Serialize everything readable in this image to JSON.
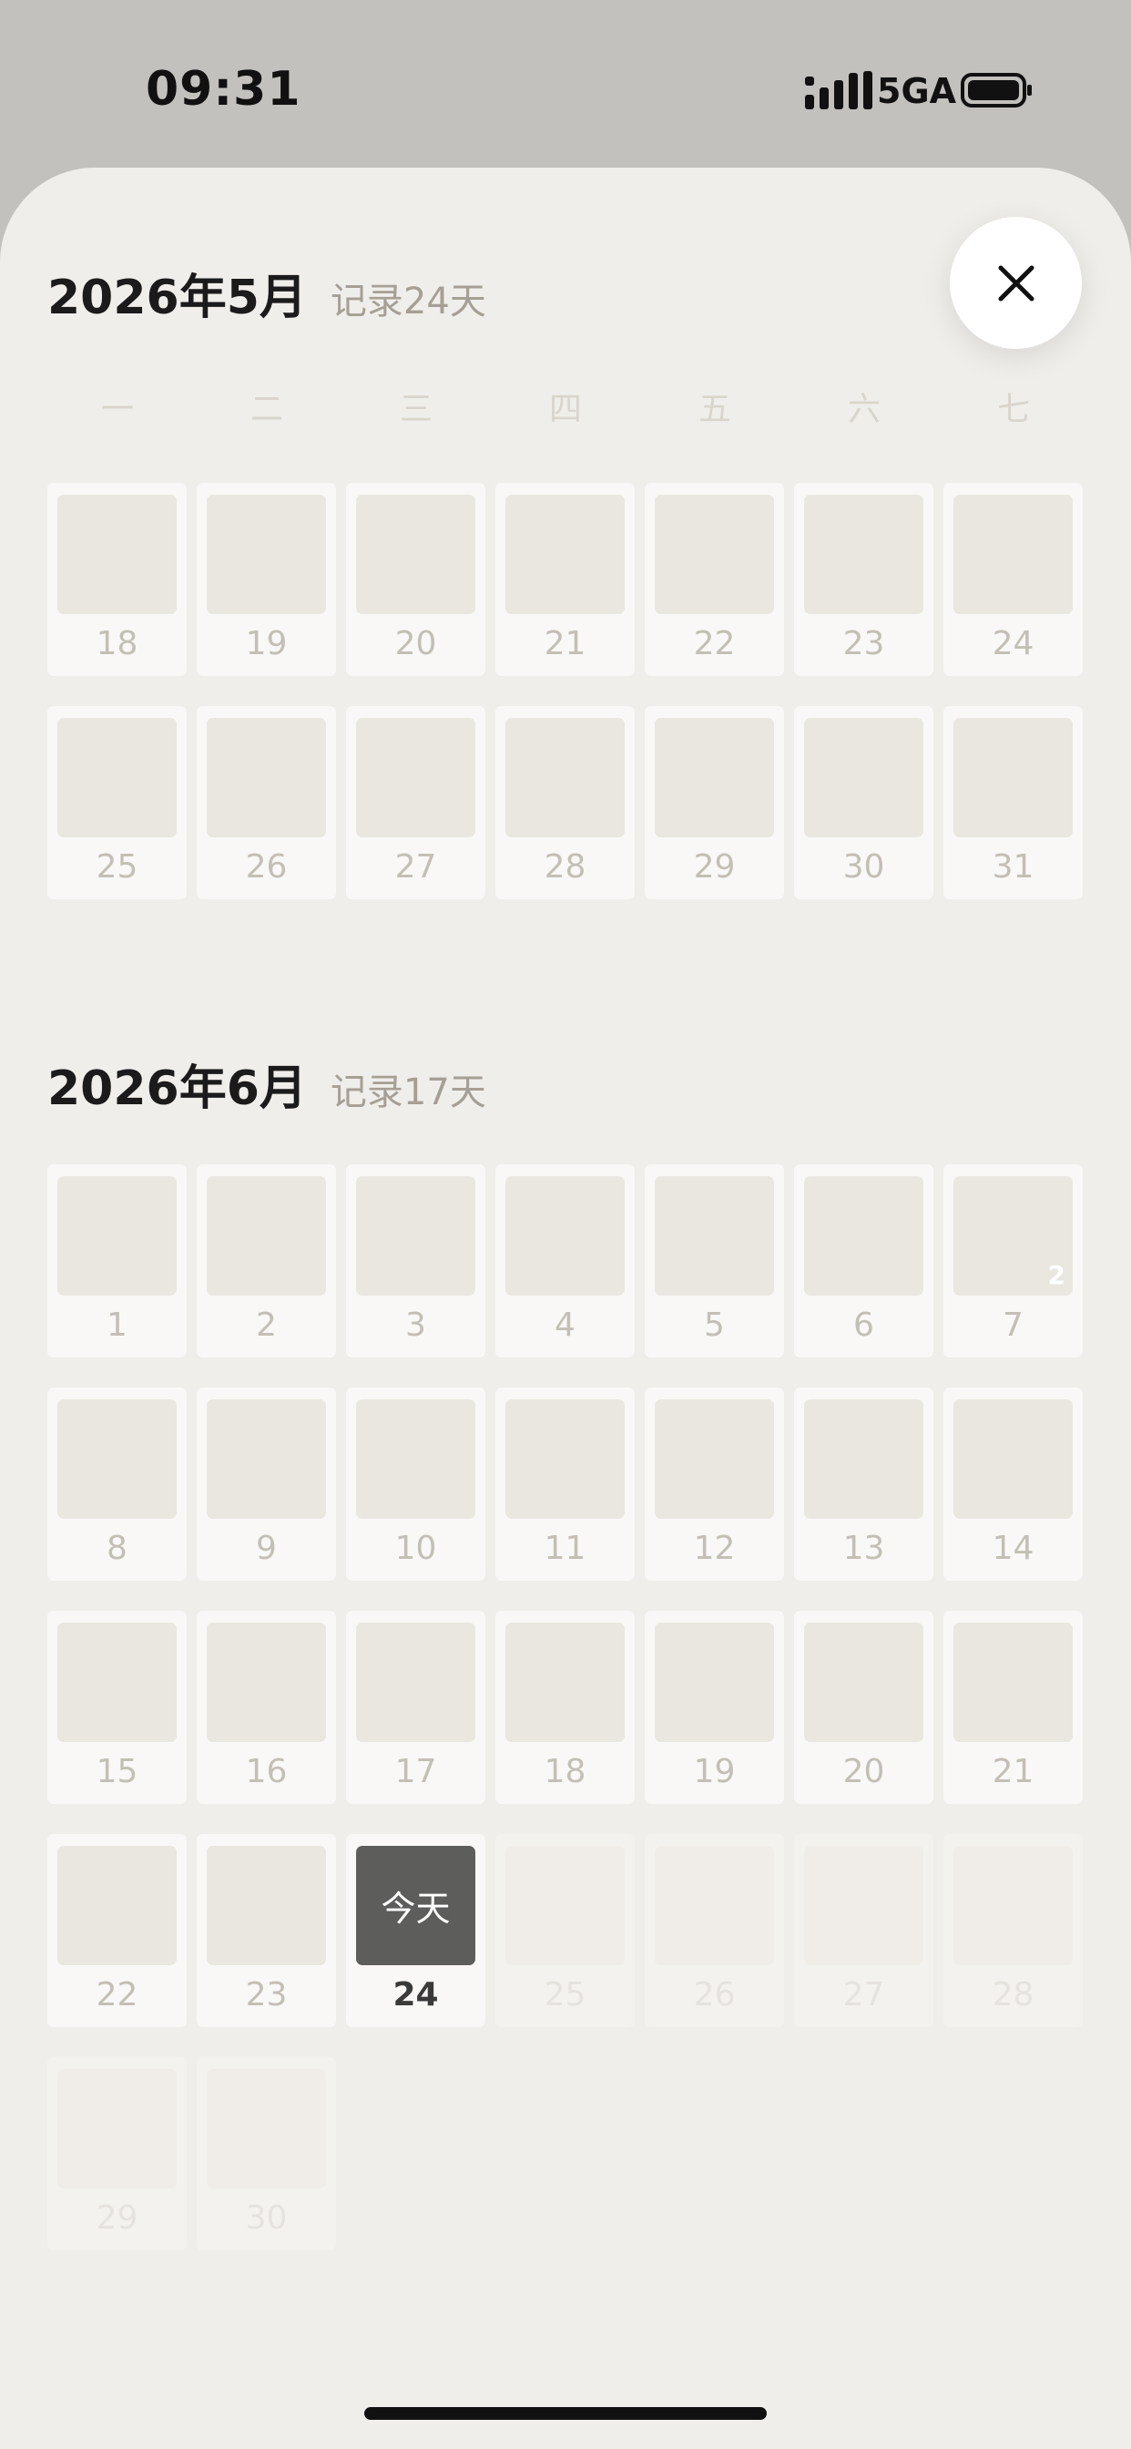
{
  "status_bar": {
    "time": "09:31",
    "network": "5GA"
  },
  "weekdays": [
    "一",
    "二",
    "三",
    "四",
    "五",
    "六",
    "七"
  ],
  "months": [
    {
      "title": "2026年5月",
      "count": "记录24天",
      "days": [
        "18",
        "19",
        "20",
        "21",
        "22",
        "23",
        "24",
        "25",
        "26",
        "27",
        "28",
        "29",
        "30",
        "31"
      ]
    },
    {
      "title": "2026年6月",
      "count": "记录17天",
      "days": [
        "1",
        "2",
        "3",
        "4",
        "5",
        "6",
        "7",
        "8",
        "9",
        "10",
        "11",
        "12",
        "13",
        "14",
        "15",
        "16",
        "17",
        "18",
        "19",
        "20",
        "21",
        "22",
        "23",
        "24",
        "25",
        "26",
        "27",
        "28",
        "29",
        "30"
      ],
      "badge_day7": "2",
      "today_label": "今天"
    }
  ]
}
